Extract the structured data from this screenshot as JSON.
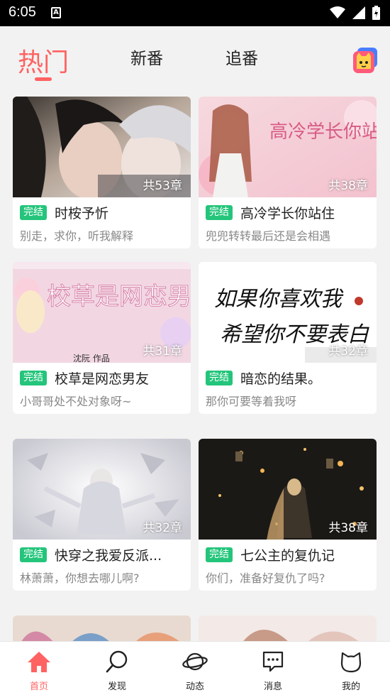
{
  "status_bar": {
    "time": "6:05"
  },
  "tabs": [
    {
      "label": "热门",
      "active": true
    },
    {
      "label": "新番",
      "active": false
    },
    {
      "label": "追番",
      "active": false
    }
  ],
  "cards": [
    {
      "title": "时桉予忻",
      "desc": "别走，求你，听我解释",
      "chapters": "共53章",
      "badge": "完结"
    },
    {
      "title": "高冷学长你站住",
      "desc": "兜兜转转最后还是会相遇",
      "chapters": "共38章",
      "badge": "完结",
      "cover_text": "高冷学长你站住"
    },
    {
      "title": "校草是网恋男友",
      "desc": "小哥哥处不处对象呀~",
      "chapters": "共31章",
      "badge": "完结",
      "cover_text": "校草是网恋男友",
      "cover_author": "沈阮 作品"
    },
    {
      "title": "暗恋的结果。",
      "desc": "那你可要等着我呀",
      "chapters": "共32章",
      "badge": "完结",
      "cover_text_1": "如果你喜欢我",
      "cover_text_2": "希望你不要表白"
    },
    {
      "title": "快穿之我爱反派...",
      "desc": "林萧萧，你想去哪儿啊?",
      "chapters": "共32章",
      "badge": "完结"
    },
    {
      "title": "七公主的复仇记",
      "desc": "你们，准备好复仇了吗?",
      "chapters": "共38章",
      "badge": "完结"
    }
  ],
  "bottom_nav": [
    {
      "label": "首页",
      "icon": "home-icon",
      "active": true
    },
    {
      "label": "发现",
      "icon": "search-icon",
      "active": false
    },
    {
      "label": "动态",
      "icon": "planet-icon",
      "active": false
    },
    {
      "label": "消息",
      "icon": "message-icon",
      "active": false
    },
    {
      "label": "我的",
      "icon": "cat-face-icon",
      "active": false
    }
  ],
  "colors": {
    "accent": "#ff6262",
    "badge": "#24c57b"
  }
}
